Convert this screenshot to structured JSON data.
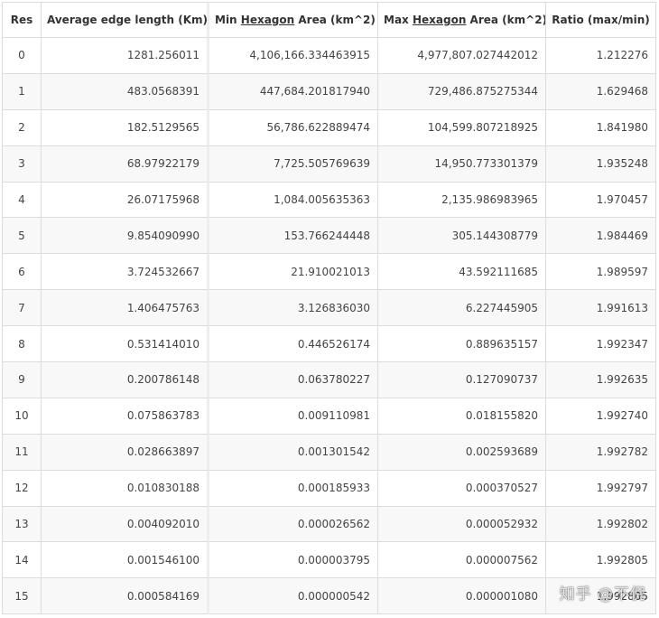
{
  "table": {
    "headers": {
      "res": "Res",
      "avg": "Average edge length (Km)",
      "min_prefix": "Min ",
      "min_ul": "Hexagon",
      "min_suffix": " Area (km^2)",
      "max_prefix": "Max ",
      "max_ul": "Hexagon",
      "max_suffix": " Area (km^2)",
      "ratio": "Ratio (max/min)"
    },
    "rows": [
      [
        "0",
        "1281.256011",
        "4,106,166.334463915",
        "4,977,807.027442012",
        "1.212276"
      ],
      [
        "1",
        "483.0568391",
        "447,684.201817940",
        "729,486.875275344",
        "1.629468"
      ],
      [
        "2",
        "182.5129565",
        "56,786.622889474",
        "104,599.807218925",
        "1.841980"
      ],
      [
        "3",
        "68.97922179",
        "7,725.505769639",
        "14,950.773301379",
        "1.935248"
      ],
      [
        "4",
        "26.07175968",
        "1,084.005635363",
        "2,135.986983965",
        "1.970457"
      ],
      [
        "5",
        "9.854090990",
        "153.766244448",
        "305.144308779",
        "1.984469"
      ],
      [
        "6",
        "3.724532667",
        "21.910021013",
        "43.592111685",
        "1.989597"
      ],
      [
        "7",
        "1.406475763",
        "3.126836030",
        "6.227445905",
        "1.991613"
      ],
      [
        "8",
        "0.531414010",
        "0.446526174",
        "0.889635157",
        "1.992347"
      ],
      [
        "9",
        "0.200786148",
        "0.063780227",
        "0.127090737",
        "1.992635"
      ],
      [
        "10",
        "0.075863783",
        "0.009110981",
        "0.018155820",
        "1.992740"
      ],
      [
        "11",
        "0.028663897",
        "0.001301542",
        "0.002593689",
        "1.992782"
      ],
      [
        "12",
        "0.010830188",
        "0.000185933",
        "0.000370527",
        "1.992797"
      ],
      [
        "13",
        "0.004092010",
        "0.000026562",
        "0.000052932",
        "1.992802"
      ],
      [
        "14",
        "0.001546100",
        "0.000003795",
        "0.000007562",
        "1.992805"
      ],
      [
        "15",
        "0.000584169",
        "0.000000542",
        "0.000001080",
        "1.992805"
      ]
    ]
  },
  "watermark": "知乎 @不倪"
}
